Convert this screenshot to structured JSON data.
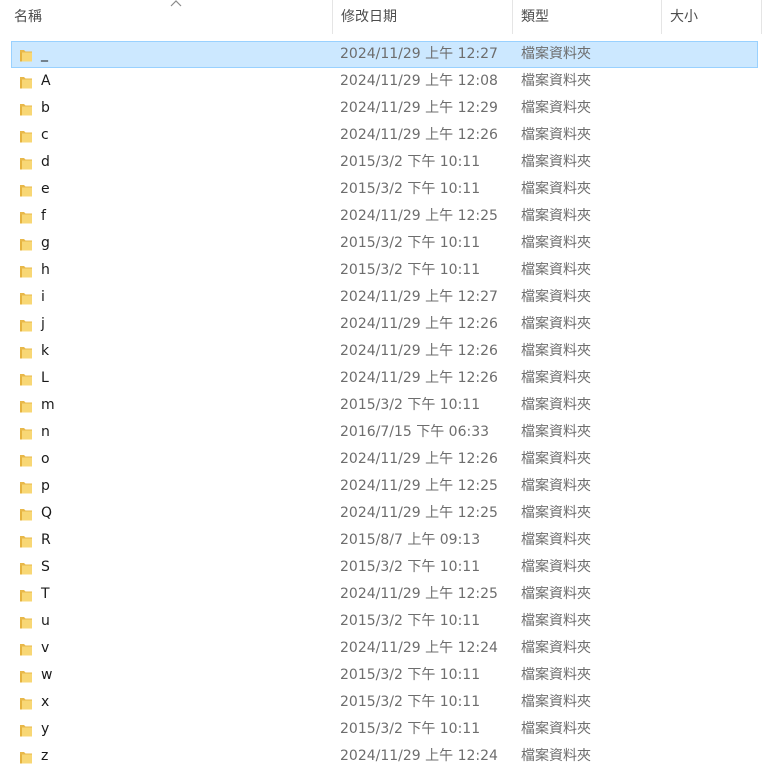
{
  "columns": {
    "name": "名稱",
    "modified": "修改日期",
    "type": "類型",
    "size": "大小"
  },
  "sort": {
    "column": "name",
    "direction": "ascending",
    "icon": "chevron-up-icon"
  },
  "accent": {
    "selected_bg": "#cce8ff",
    "selected_border": "#99d1ff",
    "folder_yellow": "#f8d775"
  },
  "rows": [
    {
      "name": "_",
      "modified": "2024/11/29 上午 12:27",
      "type": "檔案資料夾",
      "selected": true
    },
    {
      "name": "A",
      "modified": "2024/11/29 上午 12:08",
      "type": "檔案資料夾"
    },
    {
      "name": "b",
      "modified": "2024/11/29 上午 12:29",
      "type": "檔案資料夾"
    },
    {
      "name": "c",
      "modified": "2024/11/29 上午 12:26",
      "type": "檔案資料夾"
    },
    {
      "name": "d",
      "modified": "2015/3/2 下午 10:11",
      "type": "檔案資料夾"
    },
    {
      "name": "e",
      "modified": "2015/3/2 下午 10:11",
      "type": "檔案資料夾"
    },
    {
      "name": "f",
      "modified": "2024/11/29 上午 12:25",
      "type": "檔案資料夾"
    },
    {
      "name": "g",
      "modified": "2015/3/2 下午 10:11",
      "type": "檔案資料夾"
    },
    {
      "name": "h",
      "modified": "2015/3/2 下午 10:11",
      "type": "檔案資料夾"
    },
    {
      "name": "i",
      "modified": "2024/11/29 上午 12:27",
      "type": "檔案資料夾"
    },
    {
      "name": "j",
      "modified": "2024/11/29 上午 12:26",
      "type": "檔案資料夾"
    },
    {
      "name": "k",
      "modified": "2024/11/29 上午 12:26",
      "type": "檔案資料夾"
    },
    {
      "name": "L",
      "modified": "2024/11/29 上午 12:26",
      "type": "檔案資料夾"
    },
    {
      "name": "m",
      "modified": "2015/3/2 下午 10:11",
      "type": "檔案資料夾"
    },
    {
      "name": "n",
      "modified": "2016/7/15 下午 06:33",
      "type": "檔案資料夾"
    },
    {
      "name": "o",
      "modified": "2024/11/29 上午 12:26",
      "type": "檔案資料夾"
    },
    {
      "name": "p",
      "modified": "2024/11/29 上午 12:25",
      "type": "檔案資料夾"
    },
    {
      "name": "Q",
      "modified": "2024/11/29 上午 12:25",
      "type": "檔案資料夾"
    },
    {
      "name": "R",
      "modified": "2015/8/7 上午 09:13",
      "type": "檔案資料夾"
    },
    {
      "name": "S",
      "modified": "2015/3/2 下午 10:11",
      "type": "檔案資料夾"
    },
    {
      "name": "T",
      "modified": "2024/11/29 上午 12:25",
      "type": "檔案資料夾"
    },
    {
      "name": "u",
      "modified": "2015/3/2 下午 10:11",
      "type": "檔案資料夾"
    },
    {
      "name": "v",
      "modified": "2024/11/29 上午 12:24",
      "type": "檔案資料夾"
    },
    {
      "name": "w",
      "modified": "2015/3/2 下午 10:11",
      "type": "檔案資料夾"
    },
    {
      "name": "x",
      "modified": "2015/3/2 下午 10:11",
      "type": "檔案資料夾"
    },
    {
      "name": "y",
      "modified": "2015/3/2 下午 10:11",
      "type": "檔案資料夾"
    },
    {
      "name": "z",
      "modified": "2024/11/29 上午 12:24",
      "type": "檔案資料夾"
    }
  ]
}
